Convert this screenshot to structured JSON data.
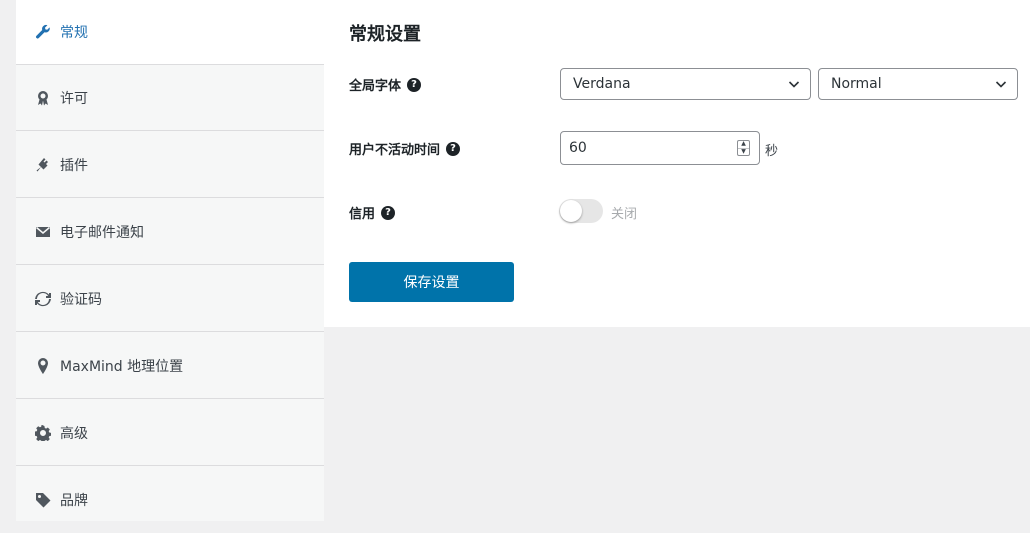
{
  "sidebar": {
    "items": [
      {
        "label": "常规",
        "icon": "wrench-icon",
        "active": true
      },
      {
        "label": "许可",
        "icon": "award-icon"
      },
      {
        "label": "插件",
        "icon": "plugin-icon"
      },
      {
        "label": "电子邮件通知",
        "icon": "email-icon"
      },
      {
        "label": "验证码",
        "icon": "refresh-icon"
      },
      {
        "label": "MaxMind 地理位置",
        "icon": "location-pin-icon"
      },
      {
        "label": "高级",
        "icon": "gear-icon"
      },
      {
        "label": "品牌",
        "icon": "tag-icon"
      }
    ]
  },
  "main": {
    "title": "常规设置",
    "font_row": {
      "label": "全局字体",
      "help": "?",
      "font_value": "Verdana",
      "weight_value": "Normal"
    },
    "inactivity_row": {
      "label": "用户不活动时间",
      "help": "?",
      "value": "60",
      "unit": "秒"
    },
    "credit_row": {
      "label": "信用",
      "help": "?",
      "toggle_text": "关闭",
      "enabled": false
    },
    "save_label": "保存设置"
  },
  "colors": {
    "accent": "#2271b1",
    "button": "#0073aa",
    "sidebar_bg": "#f6f7f7",
    "page_bg": "#f0f0f1"
  }
}
